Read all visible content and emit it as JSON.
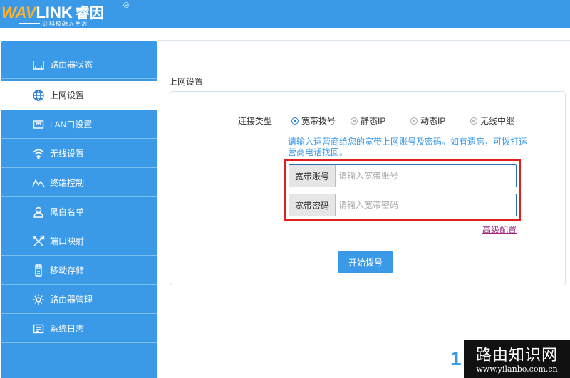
{
  "brand": {
    "logo_wav": "WAV",
    "logo_link": "LINK",
    "logo_cn": "睿因",
    "registered": "®",
    "slogan": "让科技融入生活"
  },
  "sidebar": {
    "items": [
      {
        "label": "路由器状态",
        "icon": "router-status-icon",
        "active": false
      },
      {
        "label": "上网设置",
        "icon": "globe-icon",
        "active": true
      },
      {
        "label": "LAN口设置",
        "icon": "lan-port-icon",
        "active": false
      },
      {
        "label": "无线设置",
        "icon": "wifi-icon",
        "active": false
      },
      {
        "label": "终端控制",
        "icon": "terminal-control-icon",
        "active": false
      },
      {
        "label": "黑白名单",
        "icon": "user-list-icon",
        "active": false
      },
      {
        "label": "端口映射",
        "icon": "tools-icon",
        "active": false
      },
      {
        "label": "移动存储",
        "icon": "usb-storage-icon",
        "active": false
      },
      {
        "label": "路由器管理",
        "icon": "gear-icon",
        "active": false
      },
      {
        "label": "系统日志",
        "icon": "log-icon",
        "active": false
      }
    ]
  },
  "main": {
    "section_title": "上网设置",
    "connection_type_label": "连接类型",
    "connection_options": [
      {
        "label": "宽带拨号",
        "checked": true
      },
      {
        "label": "静态IP",
        "checked": false
      },
      {
        "label": "动态IP",
        "checked": false
      },
      {
        "label": "无线中继",
        "checked": false
      }
    ],
    "hint": "请输入运营商给您的宽带上网账号及密码。如有遗忘，可拨打运营商电话找回。",
    "account": {
      "label": "宽带账号",
      "placeholder": "请输入宽带账号",
      "value": ""
    },
    "password": {
      "label": "宽带密码",
      "placeholder": "请输入宽带密码",
      "value": ""
    },
    "advanced_link": "高级配置",
    "dial_button": "开始拨号"
  },
  "page_number": "1",
  "watermark": {
    "title": "路由知识网",
    "url": "www.yilanbo.com.cn"
  },
  "colors": {
    "primary": "#3a9ae8",
    "highlight": "#e02020",
    "advanced_link": "#a0247a",
    "logo_accent": "#ffb22a"
  }
}
